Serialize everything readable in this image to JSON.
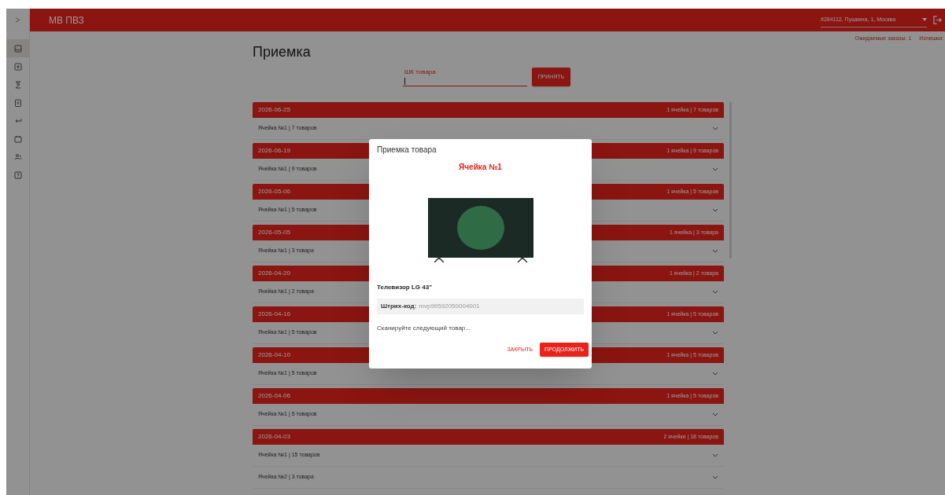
{
  "sidebar": {
    "toggle": ">",
    "items": [
      {
        "kind": "inbox",
        "selected": true
      },
      {
        "kind": "box",
        "selected": false
      },
      {
        "kind": "hourglass",
        "selected": false
      },
      {
        "kind": "clipboard",
        "selected": false
      },
      {
        "kind": "return",
        "selected": false
      },
      {
        "kind": "calendar",
        "selected": false
      },
      {
        "kind": "people",
        "selected": false
      },
      {
        "kind": "help",
        "selected": false
      }
    ]
  },
  "header": {
    "title": "МВ ПВЗ",
    "location_select": {
      "value": "#284112, Пушкина, 1, Москва"
    }
  },
  "counters": [
    "Ожидаемые заказы: 1",
    "Излишки:"
  ],
  "page_title": "Приемка",
  "scan_field": {
    "label": "ШК товара"
  },
  "accept_button": "ПРИНЯТЬ",
  "groups": [
    {
      "date": "2026-06-25",
      "summary": "1 ячейка | 7 товаров",
      "cells": [
        "Ячейка №1 | 7 товаров"
      ]
    },
    {
      "date": "2026-06-19",
      "summary": "1 ячейка | 9 товаров",
      "cells": [
        "Ячейка №1 | 9 товаров"
      ]
    },
    {
      "date": "2026-05-06",
      "summary": "1 ячейка | 5 товаров",
      "cells": [
        "Ячейка №1 | 5 товаров"
      ]
    },
    {
      "date": "2026-05-05",
      "summary": "1 ячейка | 3 товара",
      "cells": [
        "Ячейка №1 | 3 товара"
      ]
    },
    {
      "date": "2026-04-20",
      "summary": "1 ячейка | 2 товара",
      "cells": [
        "Ячейка №1 | 2 товара"
      ]
    },
    {
      "date": "2026-04-16",
      "summary": "1 ячейка | 5 товаров",
      "cells": [
        "Ячейка №1 | 5 товаров"
      ]
    },
    {
      "date": "2026-04-10",
      "summary": "1 ячейка | 5 товаров",
      "cells": [
        "Ячейка №1 | 5 товаров"
      ]
    },
    {
      "date": "2026-04-06",
      "summary": "1 ячейка | 5 товаров",
      "cells": [
        "Ячейка №1 | 5 товаров"
      ]
    },
    {
      "date": "2026-04-03",
      "summary": "2 ячейки | 18 товаров",
      "cells": [
        "Ячейка №1 | 15 товаров",
        "Ячейка №2 | 3 товара"
      ]
    }
  ],
  "modal": {
    "title": "Приемка товара",
    "cell": "Ячейка №1",
    "product": "Телевизор LG 43\"",
    "barcode_label": "Штрих-код:",
    "barcode": "mvp99592050004001",
    "status": "Сканируйте следующий товар...",
    "buttons": [
      {
        "label": "ЗАКРЫТЬ",
        "kind": "text"
      },
      {
        "label": "ПРОДОЛЖИТЬ",
        "kind": "contained"
      }
    ]
  }
}
